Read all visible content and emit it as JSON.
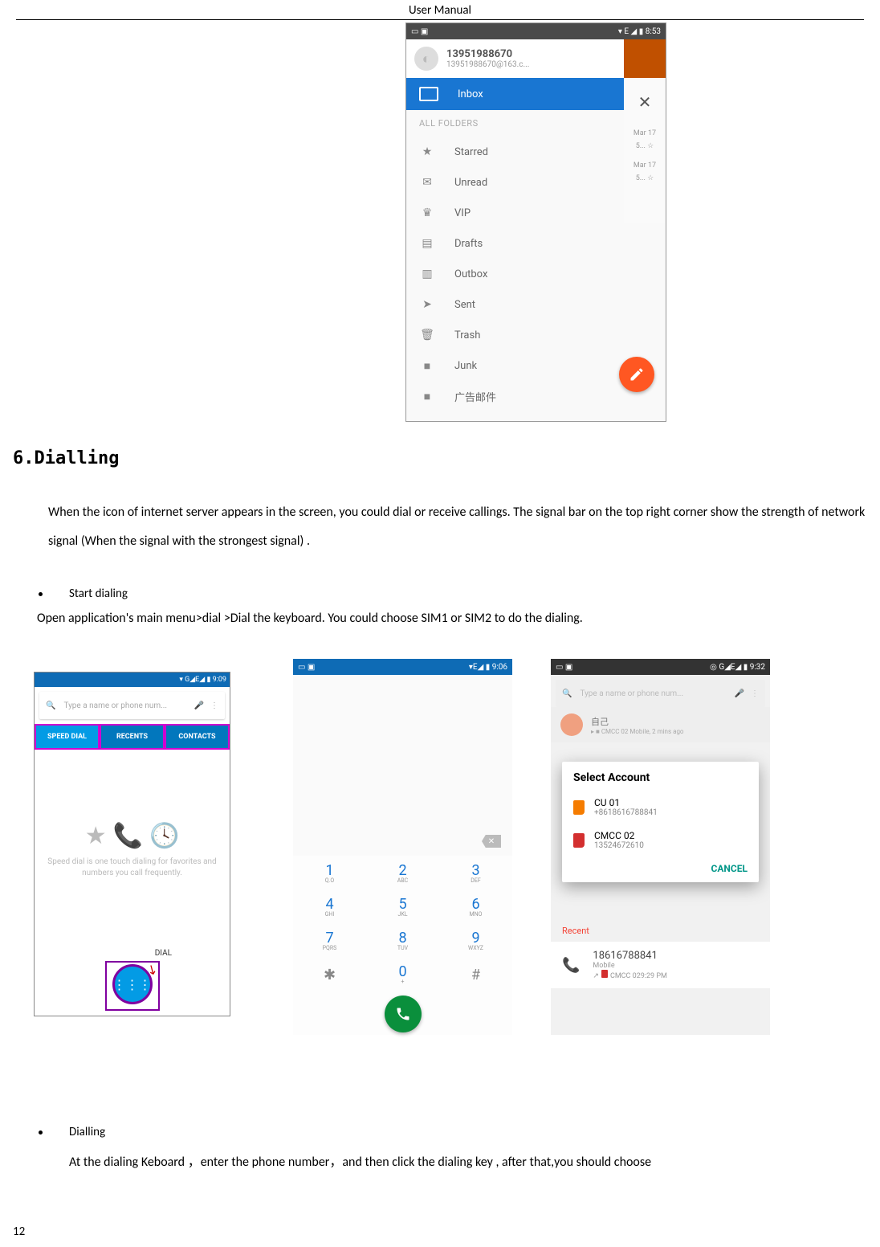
{
  "header": {
    "title": "User    Manual"
  },
  "page_number": "12",
  "ss1": {
    "status_left": "▭ ▣",
    "status_right": "▾ E ◢ ▮ 8:53",
    "profile_name": "13951988670",
    "profile_email": "13951988670@163.c...",
    "inbox": "Inbox",
    "all_folders": "ALL FOLDERS",
    "folders": [
      {
        "icon": "★",
        "label": "Starred"
      },
      {
        "icon": "✉",
        "label": "Unread"
      },
      {
        "icon": "♛",
        "label": "VIP"
      },
      {
        "icon": "▤",
        "label": "Drafts"
      },
      {
        "icon": "▥",
        "label": "Outbox"
      },
      {
        "icon": "➤",
        "label": "Sent"
      },
      {
        "icon": "🗑",
        "label": "Trash"
      },
      {
        "icon": "■",
        "label": "Junk"
      },
      {
        "icon": "■",
        "label": "广告邮件"
      }
    ],
    "peek": {
      "close": "✕",
      "d1": "Mar 17",
      "s1": "5... ☆",
      "d2": "Mar 17",
      "s2": "5... ☆"
    }
  },
  "section_heading": "6.Dialling",
  "para1": "When the icon of internet server appears in the screen, you could dial or receive callings. The signal bar on the top right corner show the strength of network signal (When the signal with the strongest signal) .",
  "bullet1": "Start dialing",
  "line1": "Open application's main menu>dial >Dial the keyboard. You could choose SIM1 or SIM2 to do the dialing.",
  "ss2": {
    "status_right": "▾ G◢E◢ ▮ 9:09",
    "search_placeholder": "Type a name or phone num...",
    "mic": "🎤",
    "menu": "⋮",
    "tabs": [
      "SPEED DIAL",
      "RECENTS",
      "CONTACTS"
    ],
    "empty_msg": "Speed dial is one touch dialing for favorites and numbers you call frequently.",
    "dial_label": "DIAL"
  },
  "ss3": {
    "status_left": "▭ ▣",
    "status_right": "▾E◢ ▮ 9:06",
    "keys": [
      {
        "d": "1",
        "l": "Q.O"
      },
      {
        "d": "2",
        "l": "ABC"
      },
      {
        "d": "3",
        "l": "DEF"
      },
      {
        "d": "4",
        "l": "GHI"
      },
      {
        "d": "5",
        "l": "JKL"
      },
      {
        "d": "6",
        "l": "MNO"
      },
      {
        "d": "7",
        "l": "PQRS"
      },
      {
        "d": "8",
        "l": "TUV"
      },
      {
        "d": "9",
        "l": "WXYZ"
      },
      {
        "d": "✱",
        "l": ""
      },
      {
        "d": "0",
        "l": "+"
      },
      {
        "d": "#",
        "l": ""
      }
    ]
  },
  "ss4": {
    "status_left": "▭ ▣",
    "status_right": "◎ G◢E◢ ▮ 9:32",
    "search_placeholder": "Type a name or phone num...",
    "mic": "🎤",
    "menu": "⋮",
    "contact_name": "自己",
    "contact_sub": "▸ ■ CMCC 02 Mobile, 2 mins ago",
    "dialog_title": "Select Account",
    "acc1_name": "CU 01",
    "acc1_num": "+8618616788841",
    "acc2_name": "CMCC 02",
    "acc2_num": "13524672610",
    "cancel": "CANCEL",
    "recent_header": "Recent",
    "recent_num": "18616788841",
    "recent_type": "Mobile",
    "recent_sub": "CMCC 029:29 PM"
  },
  "bullet2": "Dialling",
  "line2": "At the dialing Keboard  ，enter the phone number，and then click the dialing key , after that,you should choose"
}
